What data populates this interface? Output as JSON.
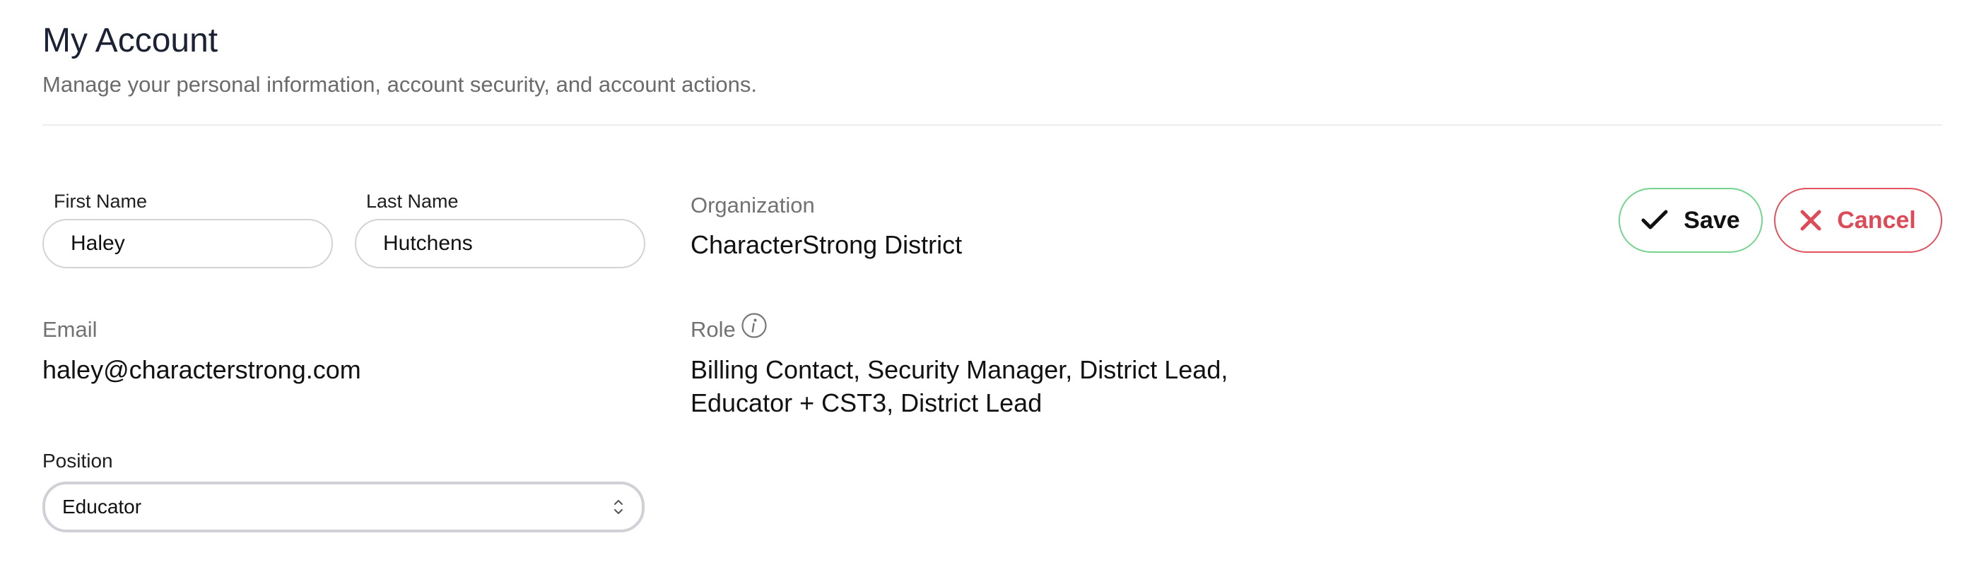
{
  "header": {
    "title": "My Account",
    "subtitle": "Manage your personal information, account security, and account actions."
  },
  "form": {
    "first_name": {
      "label": "First Name",
      "value": "Haley"
    },
    "last_name": {
      "label": "Last Name",
      "value": "Hutchens"
    },
    "email": {
      "label": "Email",
      "value": "haley@characterstrong.com"
    },
    "position": {
      "label": "Position",
      "selected": "Educator"
    }
  },
  "organization": {
    "label": "Organization",
    "value": "CharacterStrong District"
  },
  "role": {
    "label": "Role",
    "line1": "Billing Contact, Security Manager, District Lead,",
    "line2": "Educator + CST3, District Lead",
    "icon": "info-icon"
  },
  "actions": {
    "save_label": "Save",
    "cancel_label": "Cancel",
    "save_icon": "checkmark-icon",
    "cancel_icon": "close-icon"
  },
  "colors": {
    "save_border": "#74d48e",
    "cancel_border": "#e0525e",
    "cancel_text": "#dd4a58",
    "title": "#1a2233",
    "muted": "#727272"
  }
}
